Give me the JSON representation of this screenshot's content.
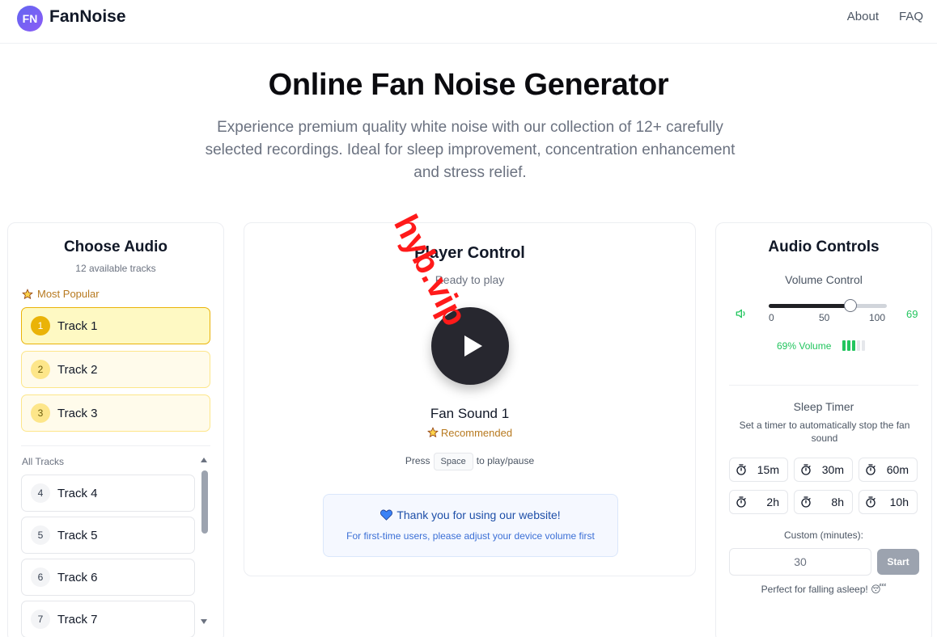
{
  "header": {
    "logo_text": "FN",
    "brand": "FanNoise",
    "nav": [
      "About",
      "FAQ"
    ]
  },
  "hero": {
    "title": "Online Fan Noise Generator",
    "description": "Experience premium quality white noise with our collection of 12+ carefully selected recordings. Ideal for sleep improvement, concentration enhancement and stress relief."
  },
  "watermark": "hyb.vip",
  "choose_audio": {
    "title": "Choose Audio",
    "subtitle": "12 available tracks",
    "popular_label": "Most Popular",
    "popular_tracks": [
      {
        "num": "1",
        "label": "Track 1",
        "active": true
      },
      {
        "num": "2",
        "label": "Track 2"
      },
      {
        "num": "3",
        "label": "Track 3"
      }
    ],
    "all_label": "All Tracks",
    "all_tracks": [
      {
        "num": "4",
        "label": "Track 4"
      },
      {
        "num": "5",
        "label": "Track 5"
      },
      {
        "num": "6",
        "label": "Track 6"
      },
      {
        "num": "7",
        "label": "Track 7"
      }
    ]
  },
  "player": {
    "title": "Player Control",
    "status": "Ready to play",
    "sound_name": "Fan Sound 1",
    "recommended": "Recommended",
    "hint_press": "Press",
    "hint_key": "Space",
    "hint_action": "to play/pause",
    "thanks_title": "Thank you for using our website!",
    "thanks_note": "For first-time users, please adjust your device volume first"
  },
  "audio_controls": {
    "title": "Audio Controls",
    "volume_label": "Volume Control",
    "volume": 69,
    "volume_value_text": "69",
    "ticks": [
      "0",
      "50",
      "100"
    ],
    "volume_percent_text": "69% Volume",
    "level_bars_on": 3,
    "level_bars_total": 5,
    "sleep_title": "Sleep Timer",
    "sleep_desc": "Set a timer to automatically stop the fan sound",
    "timers": [
      "15m",
      "30m",
      "60m",
      "2h",
      "8h",
      "10h"
    ],
    "custom_label": "Custom (minutes):",
    "custom_value": "30",
    "start_label": "Start",
    "asleep_text": "Perfect for falling asleep! 😴"
  },
  "colors": {
    "accent_green": "#22c55e",
    "gold": "#eab308",
    "play_button": "#27272f",
    "watermark": "#ff1a1a"
  }
}
